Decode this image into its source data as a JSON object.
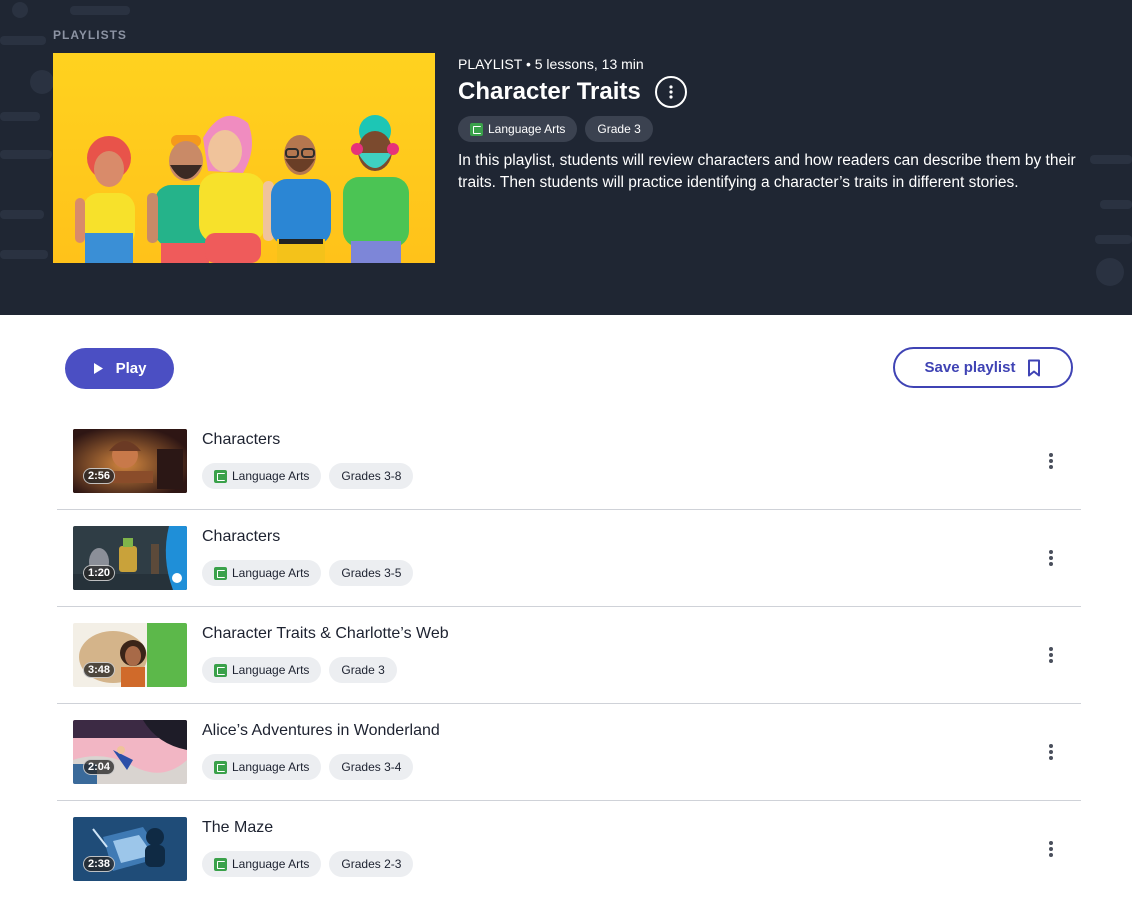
{
  "breadcrumb": "PLAYLISTS",
  "playlist": {
    "meta": "PLAYLIST • 5 lessons, 13 min",
    "title": "Character Traits",
    "tags": [
      "Language Arts",
      "Grade 3"
    ],
    "description": "In this playlist, students will review characters and how readers can describe them by their traits. Then students will practice identifying a character’s traits in different stories."
  },
  "actions": {
    "play_label": "Play",
    "save_label": "Save playlist"
  },
  "lessons": [
    {
      "title": "Characters",
      "duration": "2:56",
      "subject": "Language Arts",
      "grade": "Grades 3-8"
    },
    {
      "title": "Characters",
      "duration": "1:20",
      "subject": "Language Arts",
      "grade": "Grades 3-5"
    },
    {
      "title": "Character Traits & Charlotte’s Web",
      "duration": "3:48",
      "subject": "Language Arts",
      "grade": "Grade 3"
    },
    {
      "title": "Alice’s Adventures in Wonderland",
      "duration": "2:04",
      "subject": "Language Arts",
      "grade": "Grades 3-4"
    },
    {
      "title": "The Maze",
      "duration": "2:38",
      "subject": "Language Arts",
      "grade": "Grades 2-3"
    }
  ],
  "colors": {
    "hero_bg": "#1f2633",
    "accent": "#4b4fc3",
    "subject_green": "#3aa14a",
    "cover_yellow": "#ffc21a"
  },
  "icons": {
    "play": "play-icon",
    "bookmark": "bookmark-icon",
    "more": "more-vertical-icon",
    "subject": "book-icon"
  }
}
